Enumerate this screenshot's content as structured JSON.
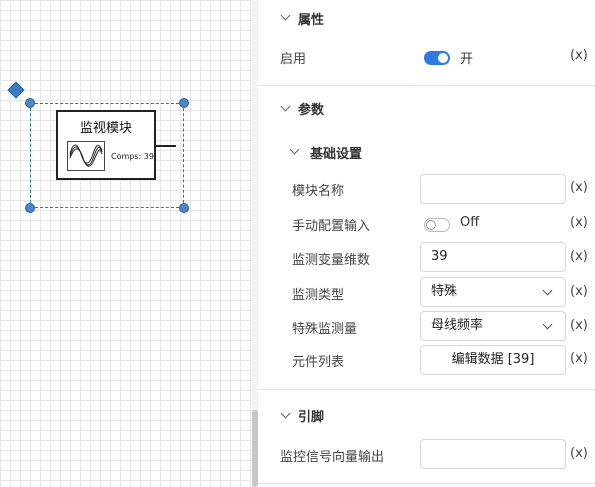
{
  "canvas": {
    "block": {
      "title": "监视模块",
      "comps_label": "Comps: 39",
      "icon": "waveform-icon"
    }
  },
  "panel": {
    "properties": {
      "title": "属性",
      "enable_label": "启用",
      "enable_state": "开",
      "enable_on": true,
      "fx": "(x)"
    },
    "params": {
      "title": "参数",
      "basic": {
        "title": "基础设置",
        "module_name_label": "模块名称",
        "module_name_value": "",
        "manual_input_label": "手动配置输入",
        "manual_input_state": "Off",
        "var_dim_label": "监测变量维数",
        "var_dim_value": "39",
        "monitor_type_label": "监测类型",
        "monitor_type_value": "特殊",
        "special_qty_label": "特殊监测量",
        "special_qty_value": "母线频率",
        "component_list_label": "元件列表",
        "component_list_button": "编辑数据 [39]"
      }
    },
    "pins": {
      "title": "引脚",
      "output_label": "监控信号向量输出",
      "output_value": ""
    }
  },
  "colors": {
    "accent": "#2f7ce0",
    "selection": "#2f6fb3"
  }
}
